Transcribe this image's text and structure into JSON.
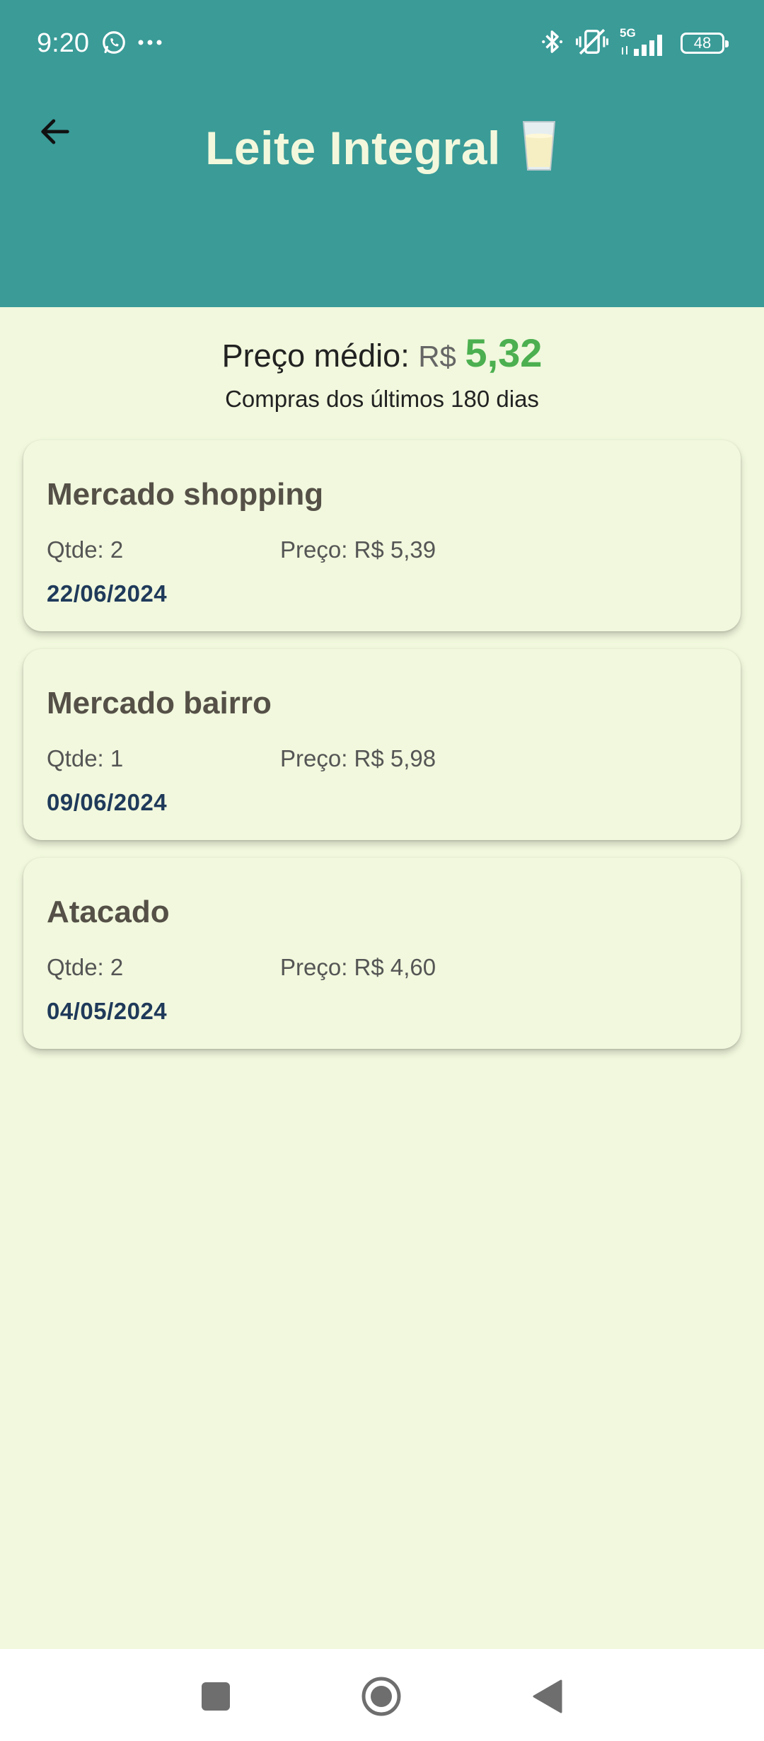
{
  "status_bar": {
    "time": "9:20",
    "left_icons": [
      "whatsapp-icon",
      "more-dots-icon"
    ],
    "right_icons": [
      "bluetooth-icon",
      "vibrate-off-icon",
      "signal-5g-icon",
      "battery-icon"
    ],
    "network": "5G",
    "battery": "48"
  },
  "header": {
    "title": "Leite Integral",
    "title_icon": "milk-glass-icon",
    "background": "#3A9B97",
    "title_color": "#F3F8DC"
  },
  "summary": {
    "label": "Preço médio: ",
    "currency": "R$",
    "value": "5,32",
    "value_color": "#4CAF50",
    "subtitle": "Compras dos últimos 180 dias"
  },
  "purchases": [
    {
      "store": "Mercado shopping",
      "qty": "Qtde: 2",
      "price": "Preço: R$ 5,39",
      "date": "22/06/2024"
    },
    {
      "store": "Mercado bairro",
      "qty": "Qtde: 1",
      "price": "Preço: R$ 5,98",
      "date": "09/06/2024"
    },
    {
      "store": "Atacado",
      "qty": "Qtde: 2",
      "price": "Preço: R$ 4,60",
      "date": "04/05/2024"
    }
  ],
  "nav": {
    "buttons": [
      "recents-square-icon",
      "home-circle-icon",
      "back-triangle-icon"
    ]
  },
  "colors": {
    "page_background": "#F1F8DD",
    "date_color": "#1F3A5A"
  }
}
